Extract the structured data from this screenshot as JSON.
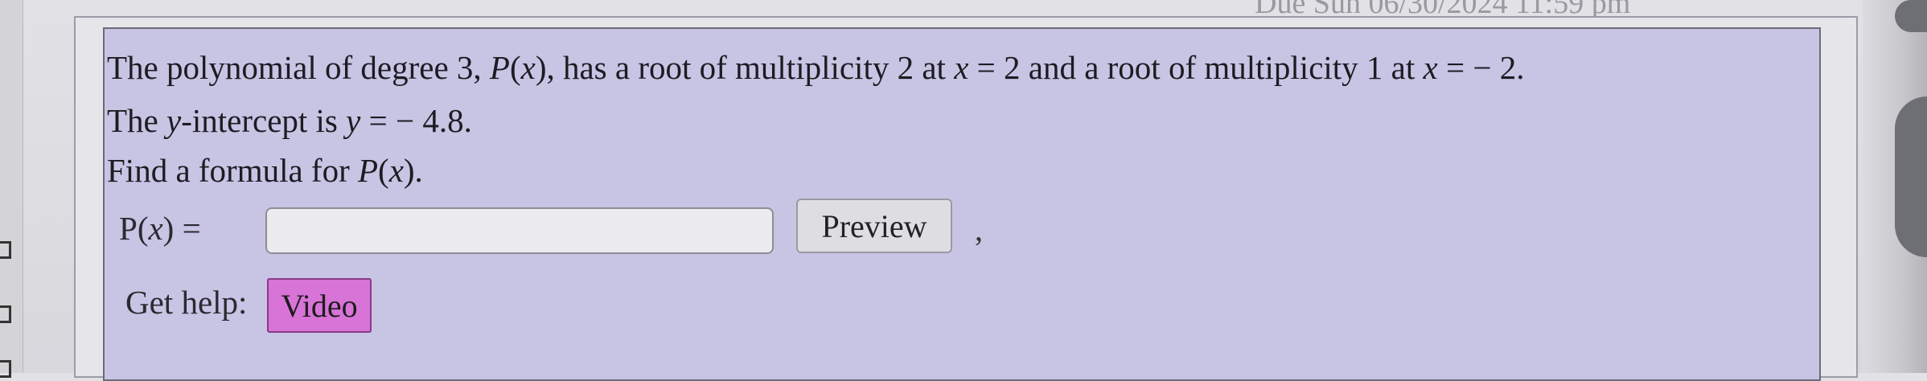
{
  "header": {
    "due_text": "Due Sun 06/30/2024 11:59 pm"
  },
  "problem": {
    "line1": {
      "text_a": "The polynomial of degree 3, ",
      "func": "P",
      "paren_open": "(",
      "var_x": "x",
      "paren_close": ")",
      "text_b": ", has a root of multiplicity 2 at ",
      "var_x2": "x",
      "text_c": " = 2 and a root of multiplicity 1 at ",
      "var_x3": "x",
      "text_d": " =  − 2."
    },
    "line2": {
      "text_a": "The ",
      "var_y": "y",
      "text_b": "-intercept is ",
      "var_y2": "y",
      "text_c": " =  − 4.8."
    },
    "line3": {
      "text_a": "Find a formula for ",
      "func": "P",
      "paren_open": "(",
      "var_x": "x",
      "paren_close": ")."
    }
  },
  "answer": {
    "label_func": "P",
    "label_paren_open": "(",
    "label_var": "x",
    "label_rest": ") =",
    "value": "",
    "placeholder": ""
  },
  "buttons": {
    "preview_label": "Preview",
    "separator": ","
  },
  "help": {
    "label": "Get help:",
    "video_label": "Video"
  },
  "colors": {
    "problem_bg": "#c8c4e4",
    "video_bg": "#d873d8",
    "preview_bg": "#dedde1"
  }
}
